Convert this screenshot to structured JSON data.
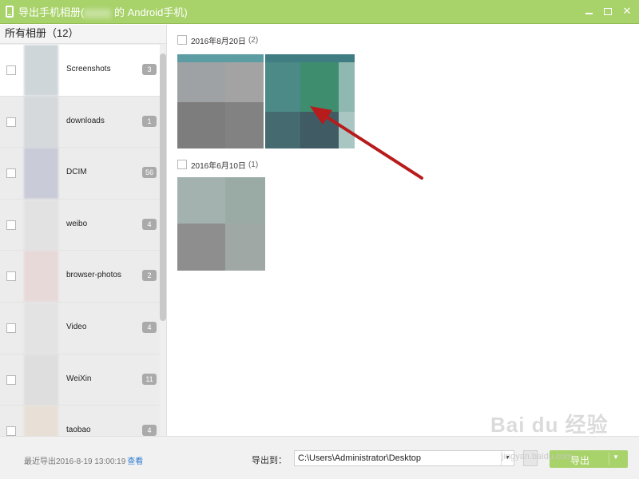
{
  "window": {
    "title": "导出手机相册(",
    "title_device": "的 Android手机)"
  },
  "sidebar": {
    "header": "所有相册（12）",
    "albums": [
      {
        "name": "Screenshots",
        "count": "3"
      },
      {
        "name": "downloads",
        "count": "1"
      },
      {
        "name": "DCIM",
        "count": "56"
      },
      {
        "name": "weibo",
        "count": "4"
      },
      {
        "name": "browser-photos",
        "count": "2"
      },
      {
        "name": "Video",
        "count": "4"
      },
      {
        "name": "WeiXin",
        "count": "11"
      },
      {
        "name": "taobao",
        "count": "4"
      }
    ]
  },
  "main": {
    "groups": [
      {
        "date": "2016年8月20日",
        "count": "(2)"
      },
      {
        "date": "2016年6月10日",
        "count": "(1)"
      }
    ]
  },
  "bottombar": {
    "recent_label": "最近导出2016-8-19 13:00:19",
    "view_link": "查看",
    "export_to_label": "导出到：",
    "path_value": "C:\\Users\\Administrator\\Desktop",
    "export_button": "导出"
  },
  "watermark": {
    "text": "Bai du 经验",
    "sub": "jingyan.baidu.com"
  },
  "colors": {
    "accent": "#a8d26a",
    "arrow": "#b81b1b"
  }
}
